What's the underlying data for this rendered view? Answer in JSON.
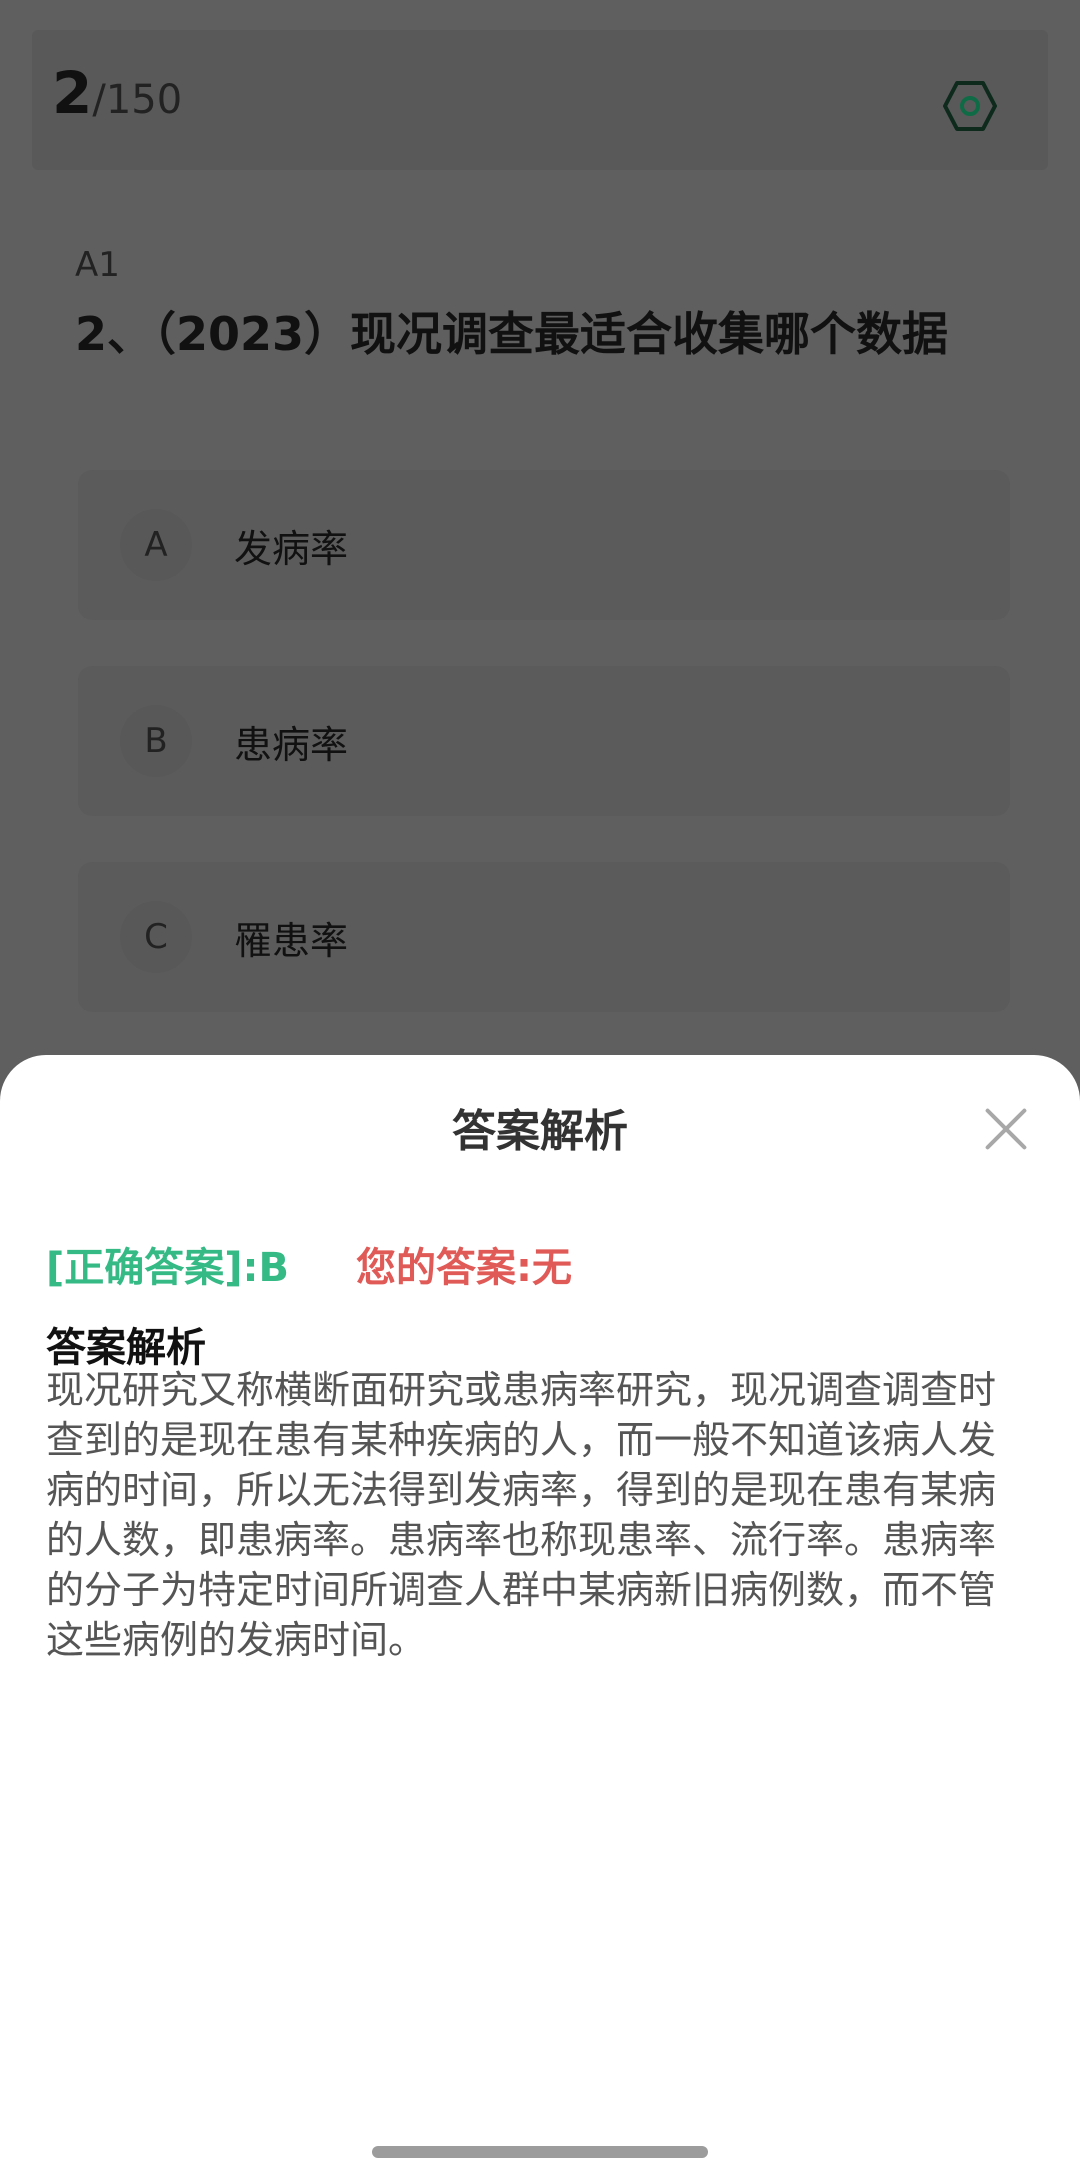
{
  "header": {
    "current": "2",
    "total": "/150",
    "settings_icon": "hexagon-settings-icon"
  },
  "question": {
    "type": "A1",
    "title": "2、（2023）现况调查最适合收集哪个数据",
    "options": [
      {
        "letter": "A",
        "text": "发病率"
      },
      {
        "letter": "B",
        "text": "患病率"
      },
      {
        "letter": "C",
        "text": "罹患率"
      }
    ]
  },
  "sheet": {
    "title": "答案解析",
    "close_icon": "close-icon",
    "correct_answer": "[正确答案]:B",
    "your_answer": "您的答案:无",
    "analysis_heading": "答案解析",
    "analysis_text": "现况研究又称横断面研究或患病率研究，现况调查调查时查到的是现在患有某种疾病的人，而一般不知道该病人发病的时间，所以无法得到发病率，得到的是现在患有某病的人数，即患病率。患病率也称现患率、流行率。患病率的分子为特定时间所调查人群中某病新旧病例数，而不管这些病例的发病时间。"
  },
  "colors": {
    "correct": "#35b985",
    "wrong": "#e05a57"
  }
}
